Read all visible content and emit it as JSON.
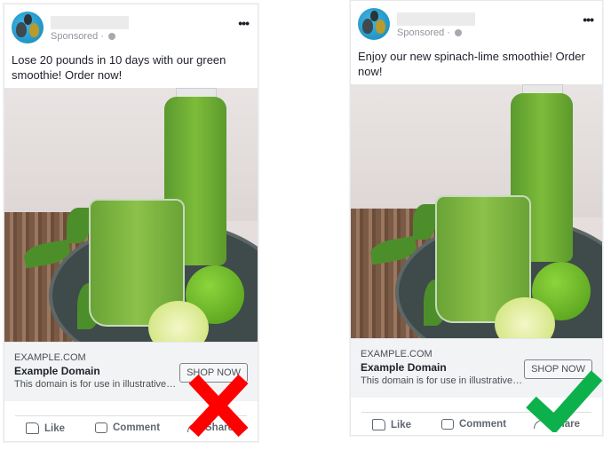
{
  "ads": [
    {
      "variant": "bad",
      "sponsored_label": "Sponsored · ",
      "post_text": "Lose 20 pounds in 10 days with our green smoothie! Order now!",
      "link": {
        "domain": "EXAMPLE.COM",
        "title": "Example Domain",
        "description": "This domain is for use in illustrative…",
        "cta_label": "SHOP NOW"
      },
      "actions": {
        "like": "Like",
        "comment": "Comment",
        "share": "Share"
      },
      "verdict": "x-mark",
      "verdict_color": "#ff0000"
    },
    {
      "variant": "good",
      "sponsored_label": "Sponsored · ",
      "post_text": "Enjoy our new spinach-lime smoothie! Order now!",
      "link": {
        "domain": "EXAMPLE.COM",
        "title": "Example Domain",
        "description": "This domain is for use in illustrative…",
        "cta_label": "SHOP NOW"
      },
      "actions": {
        "like": "Like",
        "comment": "Comment",
        "share": "Share"
      },
      "verdict": "check-mark",
      "verdict_color": "#0db14b"
    }
  ],
  "more_icon": "•••"
}
